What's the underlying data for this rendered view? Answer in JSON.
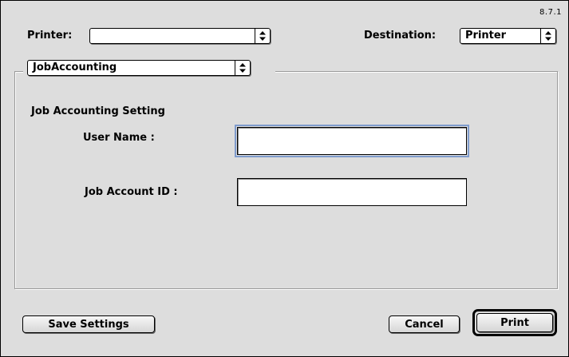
{
  "version": "8.7.1",
  "printer": {
    "label": "Printer:",
    "value": ""
  },
  "destination": {
    "label": "Destination:",
    "value": "Printer"
  },
  "panel": {
    "value": "JobAccounting"
  },
  "section": {
    "title": "Job Accounting Setting",
    "user_name_label": "User Name :",
    "user_name_value": "",
    "job_account_label": "Job Account ID :",
    "job_account_value": ""
  },
  "buttons": {
    "save_settings": "Save Settings",
    "cancel": "Cancel",
    "print": "Print"
  },
  "icons": {
    "popup_arrows": "up-down-arrows-icon"
  }
}
